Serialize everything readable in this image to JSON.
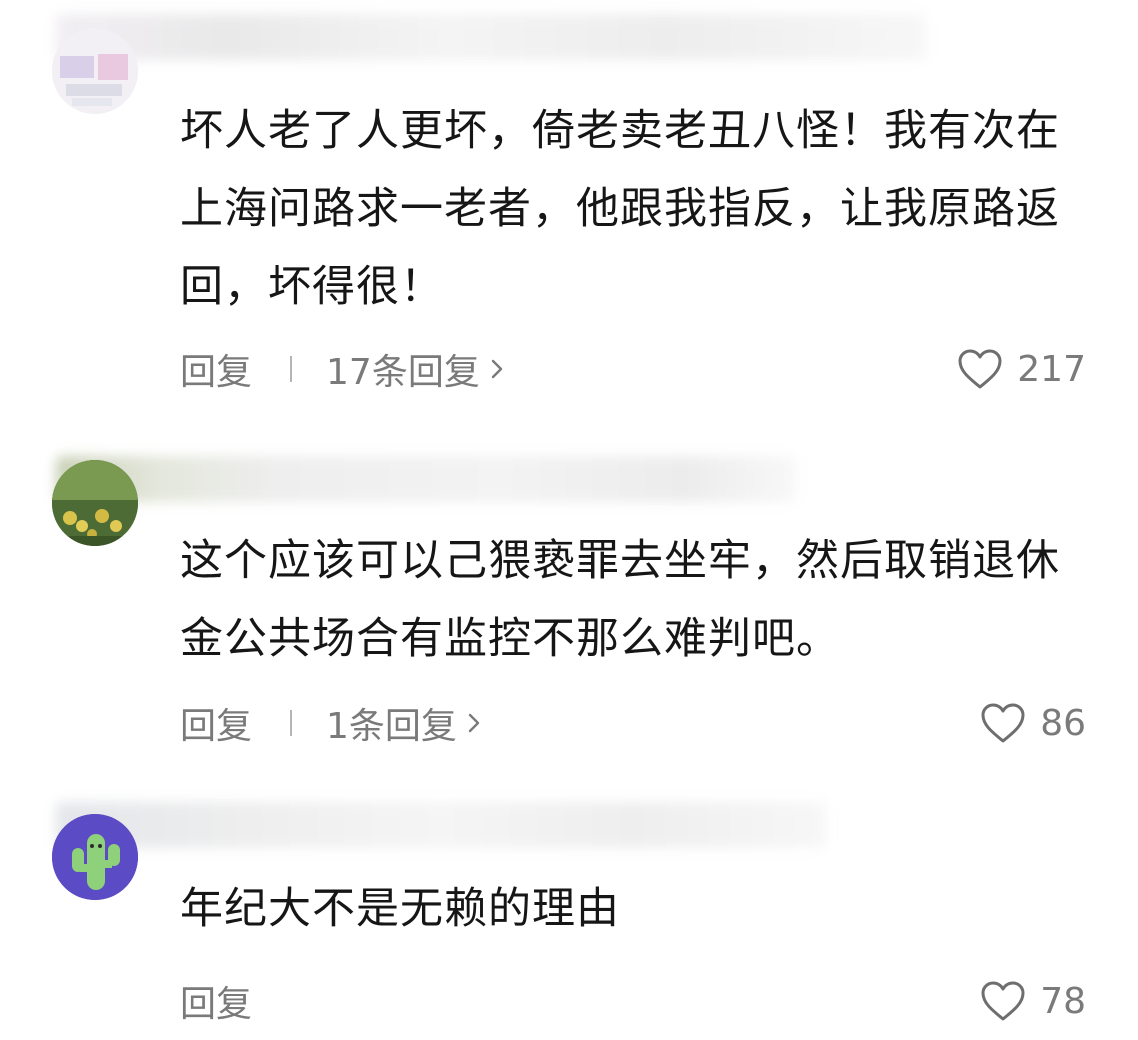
{
  "comments": [
    {
      "text": "坏人老了人更坏，倚老卖老丑八怪！我有次在上海问路求一老者，他跟我指反，让我原路返回，坏得很！",
      "reply_label": "回复",
      "replies_label": "17条回复",
      "likes": "217"
    },
    {
      "text": "这个应该可以己猥亵罪去坐牢，然后取销退休金公共场合有监控不那么难判吧。",
      "reply_label": "回复",
      "replies_label": "1条回复",
      "likes": "86"
    },
    {
      "text": "年纪大不是无赖的理由",
      "reply_label": "回复",
      "likes": "78"
    }
  ],
  "icons": {
    "heart": "heart-outline-icon",
    "chevron": "chevron-right-icon"
  },
  "colors": {
    "text": "#161616",
    "meta": "#7a7a7a",
    "separator": "#b5b5b5"
  }
}
